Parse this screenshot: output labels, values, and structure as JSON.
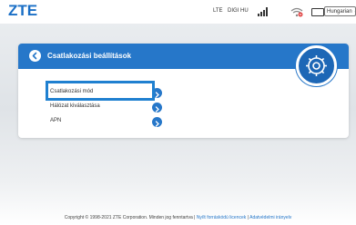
{
  "brand": {
    "logo": "ZTE"
  },
  "status_bar": {
    "network_type": "LTE",
    "operator": "DIGI HU",
    "language": "Hungarian"
  },
  "panel": {
    "title": "Csatlakozási beállítások",
    "items": [
      {
        "label": "Csatlakozási mód"
      },
      {
        "label": "Hálózat kiválasztása"
      },
      {
        "label": "APN"
      }
    ]
  },
  "footer": {
    "copyright": "Copyright © 1998-2021 ZTE Corporation. Minden jog fenntartva",
    "separator1": "|",
    "link_licenses": "Nyílt forráskódú licencek",
    "separator2": "|",
    "link_privacy": "Adatvédelmi irányelv"
  },
  "colors": {
    "accent": "#2677c9",
    "brand": "#1a6fc6"
  }
}
